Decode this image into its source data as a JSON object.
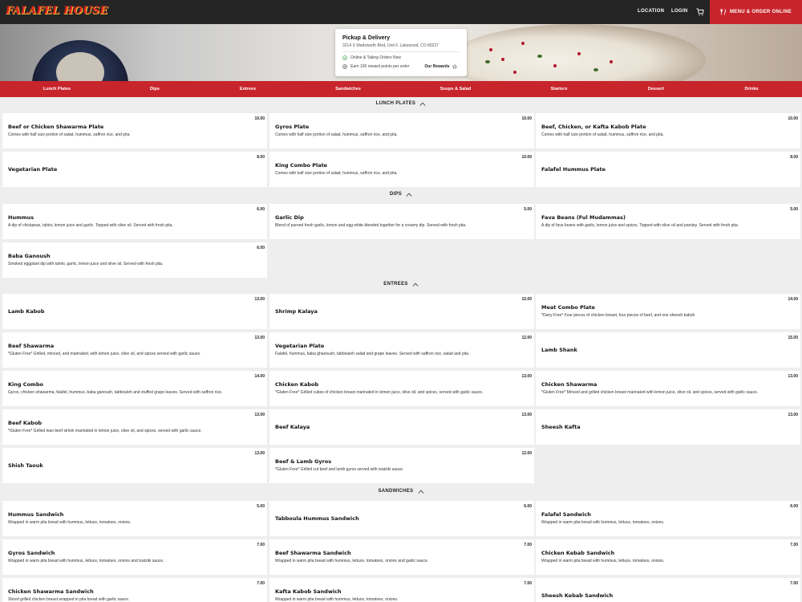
{
  "header": {
    "logo": "FALAFEL HOUSE",
    "nav": [
      "LOCATION",
      "LOGIN"
    ],
    "cart_icon": "cart-icon",
    "order_button": "MENU & ORDER ONLINE",
    "colors": {
      "bar": "#242424",
      "accent": "#c8242b"
    }
  },
  "pickup": {
    "title": "Pickup & Delivery",
    "address": "3214 S Wadsworth Blvd, Unit F, Lakewood, CO 80227",
    "status": "Online & Taking Orders Now",
    "reward_text": "Earn 100 reward points per order",
    "rewards_link": "Our Rewards"
  },
  "categories": [
    "Lunch Plates",
    "Dips",
    "Entrees",
    "Sandwiches",
    "Soups & Salad",
    "Starters",
    "Dessert",
    "Drinks"
  ],
  "sections": [
    {
      "title": "LUNCH PLATES",
      "items": [
        {
          "name": "Beef or Chicken Shawarma Plate",
          "price": "10.00",
          "desc": "Comes with half size portion of salad, hummus, saffron rice, and pita."
        },
        {
          "name": "Gyros Plate",
          "price": "10.00",
          "desc": "Comes with half size portion of salad, hummus, saffron rice, and pita."
        },
        {
          "name": "Beef, Chicken, or Kafta Kabob Plate",
          "price": "10.00",
          "desc": "Comes with half size portion of salad, hummus, saffron rice, and pita."
        },
        {
          "name": "Vegetarian Plate",
          "price": "8.00",
          "desc": ""
        },
        {
          "name": "King Combo Plate",
          "price": "10.00",
          "desc": "Comes with half size portion of salad, hummus, saffron rice, and pita."
        },
        {
          "name": "Falafel Hummus Plate",
          "price": "8.00",
          "desc": ""
        }
      ]
    },
    {
      "title": "DIPS",
      "items": [
        {
          "name": "Hummus",
          "price": "6.00",
          "desc": "A dip of chickpeas, tahini, lemon juice and garlic. Topped with olive oil. Served with fresh pita."
        },
        {
          "name": "Garlic Dip",
          "price": "5.00",
          "desc": "Blend of pureed fresh garlic, lemon and egg white blended together for a creamy dip. Served with fresh pita."
        },
        {
          "name": "Fava Beans (Ful Mudammas)",
          "price": "5.00",
          "desc": "A dip of fava beans with garlic, lemon juice and spices. Topped with olive oil and parsley. Served with fresh pita."
        },
        {
          "name": "Baba Ganoush",
          "price": "6.00",
          "desc": "Smoked eggplant dip with tahini, garlic, lemon juice and olive oil. Served with fresh pita."
        }
      ]
    },
    {
      "title": "ENTREES",
      "items": [
        {
          "name": "Lamb Kabob",
          "price": "13.00",
          "desc": ""
        },
        {
          "name": "Shrimp Kalaya",
          "price": "15.00",
          "desc": ""
        },
        {
          "name": "Meat Combo Plate",
          "price": "14.00",
          "desc": "*Dairy Free* Four pieces of chicken breast, four pieces of beef, and one sheesh kabob"
        },
        {
          "name": "Beef Shawarma",
          "price": "13.00",
          "desc": "*Gluten Free* Grilled, minced, and marinated, with lemon juice, olive oil, and spices served with garlic sauce."
        },
        {
          "name": "Vegetarian Plate",
          "price": "12.00",
          "desc": "Falafel, hummus, baba ghanoush, tabbouleh salad and grape leaves. Served with saffron rice, salad and pita."
        },
        {
          "name": "Lamb Shank",
          "price": "15.00",
          "desc": ""
        },
        {
          "name": "King Combo",
          "price": "14.00",
          "desc": "Gyros, chicken shawarma, falafel, hummus, baba ganoush, tabbouleh and stuffed grape leaves. Served with saffron rice."
        },
        {
          "name": "Chicken Kabob",
          "price": "13.00",
          "desc": "*Gluten Free* Grilled cubes of chicken breast marinated in lemon juice, olive oil, and spices, served with garlic sauce."
        },
        {
          "name": "Chicken Shawarma",
          "price": "13.00",
          "desc": "*Gluten Free* Minced and grilled chicken breast marinated with lemon juice, olive oil, and spices, served with garlic sauce."
        },
        {
          "name": "Beef Kabob",
          "price": "13.00",
          "desc": "*Gluten Free* Grilled lean beef sirloin marinated in lemon juice, olive oil, and spices, served with garlic sauce."
        },
        {
          "name": "Beef Kalaya",
          "price": "13.00",
          "desc": ""
        },
        {
          "name": "Sheesh Kafta",
          "price": "13.00",
          "desc": ""
        },
        {
          "name": "Shish Taouk",
          "price": "13.00",
          "desc": ""
        },
        {
          "name": "Beef & Lamb Gyros",
          "price": "12.00",
          "desc": "*Gluten Free* Grilled cut beef and lamb gyros served with tzatziki sauce."
        }
      ]
    },
    {
      "title": "SANDWICHES",
      "items": [
        {
          "name": "Hummus Sandwich",
          "price": "5.00",
          "desc": "Wrapped in warm pita bread with hummus, lettuce, tomatoes, onions."
        },
        {
          "name": "Tabboula Hummus Sandwich",
          "price": "6.00",
          "desc": ""
        },
        {
          "name": "Falafel Sandwich",
          "price": "6.00",
          "desc": "Wrapped in warm pita bread with hummus, lettuce, tomatoes, onions."
        },
        {
          "name": "Gyros Sandwich",
          "price": "7.00",
          "desc": "Wrapped in warm pita bread with hummus, lettuce, tomatoes, onions and tzatziki sauce."
        },
        {
          "name": "Beef Shawarma Sandwich",
          "price": "7.00",
          "desc": "Wrapped in warm pita bread with hummus, lettuce, tomatoes, onions and garlic sauce."
        },
        {
          "name": "Chicken Kebab Sandwich",
          "price": "7.00",
          "desc": "Wrapped in warm pita bread with hummus, lettuce, tomatoes, onions."
        },
        {
          "name": "Chicken Shawarma Sandwich",
          "price": "7.00",
          "desc": "Sliced grilled chicken breast wrapped in pita bread with garlic sauce."
        },
        {
          "name": "Kafta Kabob Sandwich",
          "price": "7.00",
          "desc": "Wrapped in warm pita bread with hummus, lettuce, tomatoes, onions."
        },
        {
          "name": "Sheesh Kebab Sandwich",
          "price": "7.00",
          "desc": ""
        }
      ]
    }
  ]
}
